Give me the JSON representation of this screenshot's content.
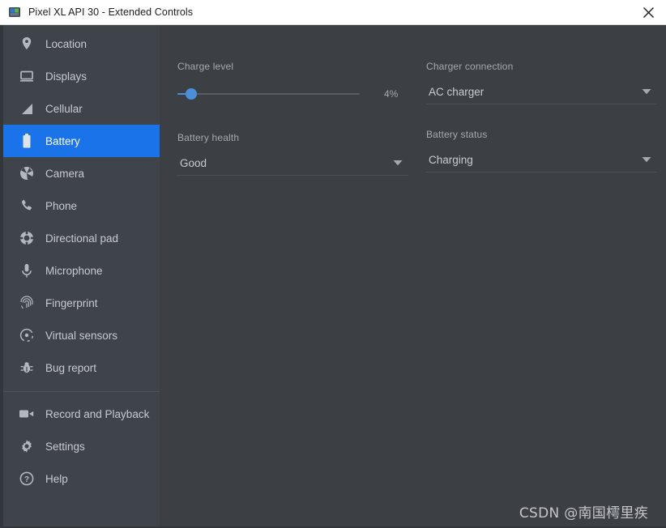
{
  "window": {
    "title": "Pixel XL API 30 - Extended Controls",
    "app_icon": "android-emulator-icon",
    "close_label": "close-icon"
  },
  "sidebar": {
    "groups": [
      {
        "items": [
          {
            "label": "Location",
            "icon": "location-pin-icon",
            "selected": false
          },
          {
            "label": "Displays",
            "icon": "monitor-icon",
            "selected": false
          },
          {
            "label": "Cellular",
            "icon": "signal-bars-icon",
            "selected": false
          },
          {
            "label": "Battery",
            "icon": "battery-icon",
            "selected": true
          },
          {
            "label": "Camera",
            "icon": "camera-aperture-icon",
            "selected": false
          },
          {
            "label": "Phone",
            "icon": "phone-handset-icon",
            "selected": false
          },
          {
            "label": "Directional pad",
            "icon": "dpad-icon",
            "selected": false
          },
          {
            "label": "Microphone",
            "icon": "microphone-icon",
            "selected": false
          },
          {
            "label": "Fingerprint",
            "icon": "fingerprint-icon",
            "selected": false
          },
          {
            "label": "Virtual sensors",
            "icon": "virtual-sensors-icon",
            "selected": false
          },
          {
            "label": "Bug report",
            "icon": "bug-icon",
            "selected": false
          }
        ]
      },
      {
        "items": [
          {
            "label": "Record and Playback",
            "icon": "video-camera-icon",
            "selected": false
          },
          {
            "label": "Settings",
            "icon": "gear-icon",
            "selected": false
          },
          {
            "label": "Help",
            "icon": "help-circle-icon",
            "selected": false
          }
        ]
      }
    ]
  },
  "main": {
    "charge_level": {
      "label": "Charge level",
      "value_text": "4%",
      "value": 4,
      "min": 0,
      "max": 100
    },
    "charger_connection": {
      "label": "Charger connection",
      "value": "AC charger"
    },
    "battery_health": {
      "label": "Battery health",
      "value": "Good"
    },
    "battery_status": {
      "label": "Battery status",
      "value": "Charging"
    }
  },
  "watermark": {
    "text": "CSDN @南国樗里疾"
  },
  "colors": {
    "accent": "#1a73e8",
    "slider_accent": "#4a90d9",
    "sidebar_bg": "#3f434a",
    "main_bg": "#3c4045",
    "titlebar_bg": "#ffffff"
  }
}
